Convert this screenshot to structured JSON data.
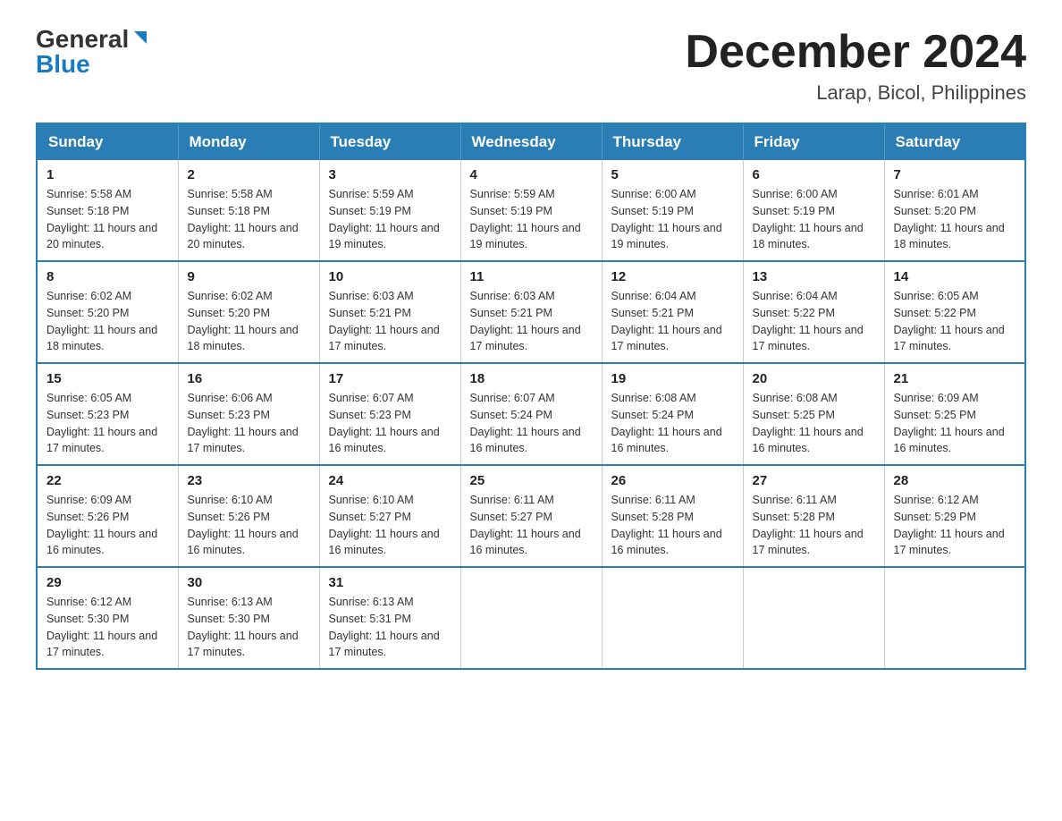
{
  "logo": {
    "general": "General",
    "blue": "Blue"
  },
  "title": {
    "month_year": "December 2024",
    "location": "Larap, Bicol, Philippines"
  },
  "weekdays": [
    "Sunday",
    "Monday",
    "Tuesday",
    "Wednesday",
    "Thursday",
    "Friday",
    "Saturday"
  ],
  "weeks": [
    [
      {
        "day": "1",
        "sunrise": "5:58 AM",
        "sunset": "5:18 PM",
        "daylight": "11 hours and 20 minutes."
      },
      {
        "day": "2",
        "sunrise": "5:58 AM",
        "sunset": "5:18 PM",
        "daylight": "11 hours and 20 minutes."
      },
      {
        "day": "3",
        "sunrise": "5:59 AM",
        "sunset": "5:19 PM",
        "daylight": "11 hours and 19 minutes."
      },
      {
        "day": "4",
        "sunrise": "5:59 AM",
        "sunset": "5:19 PM",
        "daylight": "11 hours and 19 minutes."
      },
      {
        "day": "5",
        "sunrise": "6:00 AM",
        "sunset": "5:19 PM",
        "daylight": "11 hours and 19 minutes."
      },
      {
        "day": "6",
        "sunrise": "6:00 AM",
        "sunset": "5:19 PM",
        "daylight": "11 hours and 18 minutes."
      },
      {
        "day": "7",
        "sunrise": "6:01 AM",
        "sunset": "5:20 PM",
        "daylight": "11 hours and 18 minutes."
      }
    ],
    [
      {
        "day": "8",
        "sunrise": "6:02 AM",
        "sunset": "5:20 PM",
        "daylight": "11 hours and 18 minutes."
      },
      {
        "day": "9",
        "sunrise": "6:02 AM",
        "sunset": "5:20 PM",
        "daylight": "11 hours and 18 minutes."
      },
      {
        "day": "10",
        "sunrise": "6:03 AM",
        "sunset": "5:21 PM",
        "daylight": "11 hours and 17 minutes."
      },
      {
        "day": "11",
        "sunrise": "6:03 AM",
        "sunset": "5:21 PM",
        "daylight": "11 hours and 17 minutes."
      },
      {
        "day": "12",
        "sunrise": "6:04 AM",
        "sunset": "5:21 PM",
        "daylight": "11 hours and 17 minutes."
      },
      {
        "day": "13",
        "sunrise": "6:04 AM",
        "sunset": "5:22 PM",
        "daylight": "11 hours and 17 minutes."
      },
      {
        "day": "14",
        "sunrise": "6:05 AM",
        "sunset": "5:22 PM",
        "daylight": "11 hours and 17 minutes."
      }
    ],
    [
      {
        "day": "15",
        "sunrise": "6:05 AM",
        "sunset": "5:23 PM",
        "daylight": "11 hours and 17 minutes."
      },
      {
        "day": "16",
        "sunrise": "6:06 AM",
        "sunset": "5:23 PM",
        "daylight": "11 hours and 17 minutes."
      },
      {
        "day": "17",
        "sunrise": "6:07 AM",
        "sunset": "5:23 PM",
        "daylight": "11 hours and 16 minutes."
      },
      {
        "day": "18",
        "sunrise": "6:07 AM",
        "sunset": "5:24 PM",
        "daylight": "11 hours and 16 minutes."
      },
      {
        "day": "19",
        "sunrise": "6:08 AM",
        "sunset": "5:24 PM",
        "daylight": "11 hours and 16 minutes."
      },
      {
        "day": "20",
        "sunrise": "6:08 AM",
        "sunset": "5:25 PM",
        "daylight": "11 hours and 16 minutes."
      },
      {
        "day": "21",
        "sunrise": "6:09 AM",
        "sunset": "5:25 PM",
        "daylight": "11 hours and 16 minutes."
      }
    ],
    [
      {
        "day": "22",
        "sunrise": "6:09 AM",
        "sunset": "5:26 PM",
        "daylight": "11 hours and 16 minutes."
      },
      {
        "day": "23",
        "sunrise": "6:10 AM",
        "sunset": "5:26 PM",
        "daylight": "11 hours and 16 minutes."
      },
      {
        "day": "24",
        "sunrise": "6:10 AM",
        "sunset": "5:27 PM",
        "daylight": "11 hours and 16 minutes."
      },
      {
        "day": "25",
        "sunrise": "6:11 AM",
        "sunset": "5:27 PM",
        "daylight": "11 hours and 16 minutes."
      },
      {
        "day": "26",
        "sunrise": "6:11 AM",
        "sunset": "5:28 PM",
        "daylight": "11 hours and 16 minutes."
      },
      {
        "day": "27",
        "sunrise": "6:11 AM",
        "sunset": "5:28 PM",
        "daylight": "11 hours and 17 minutes."
      },
      {
        "day": "28",
        "sunrise": "6:12 AM",
        "sunset": "5:29 PM",
        "daylight": "11 hours and 17 minutes."
      }
    ],
    [
      {
        "day": "29",
        "sunrise": "6:12 AM",
        "sunset": "5:30 PM",
        "daylight": "11 hours and 17 minutes."
      },
      {
        "day": "30",
        "sunrise": "6:13 AM",
        "sunset": "5:30 PM",
        "daylight": "11 hours and 17 minutes."
      },
      {
        "day": "31",
        "sunrise": "6:13 AM",
        "sunset": "5:31 PM",
        "daylight": "11 hours and 17 minutes."
      },
      null,
      null,
      null,
      null
    ]
  ]
}
